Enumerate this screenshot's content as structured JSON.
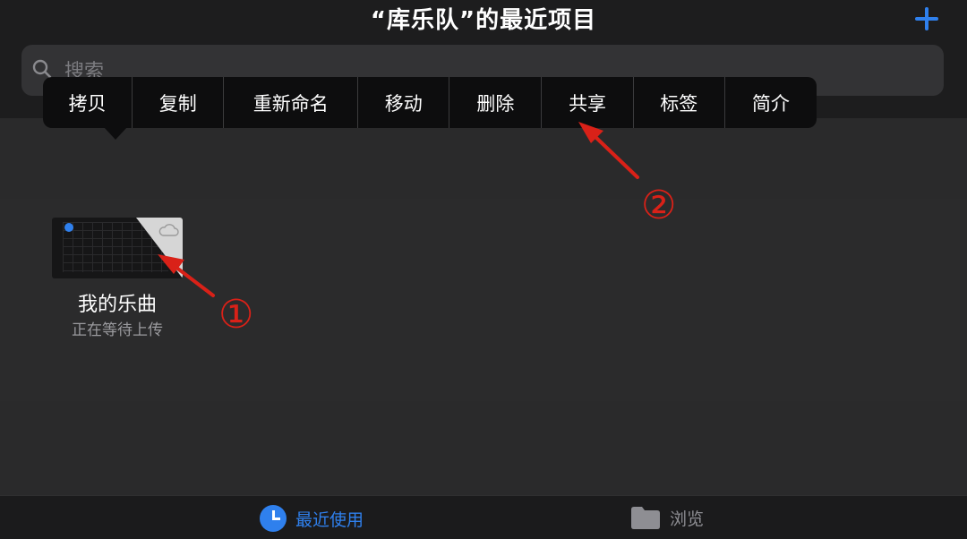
{
  "header": {
    "title": "“库乐队”的最近项目",
    "add_label": "+"
  },
  "search": {
    "placeholder": "搜索"
  },
  "context_menu": {
    "items": [
      {
        "label": "拷贝"
      },
      {
        "label": "复制"
      },
      {
        "label": "重新命名"
      },
      {
        "label": "移动"
      },
      {
        "label": "删除"
      },
      {
        "label": "共享"
      },
      {
        "label": "标签"
      },
      {
        "label": "简介"
      }
    ]
  },
  "document": {
    "name": "我的乐曲",
    "status": "正在等待上传"
  },
  "annotations": [
    {
      "label": "①"
    },
    {
      "label": "②"
    }
  ],
  "tabbar": {
    "tabs": [
      {
        "label": "最近使用",
        "icon": "clock-icon",
        "active": true
      },
      {
        "label": "浏览",
        "icon": "folder-icon",
        "active": false
      }
    ]
  },
  "colors": {
    "accent": "#2f80ed",
    "annotation": "#d92118",
    "menu_bg": "#0d0d0e"
  }
}
